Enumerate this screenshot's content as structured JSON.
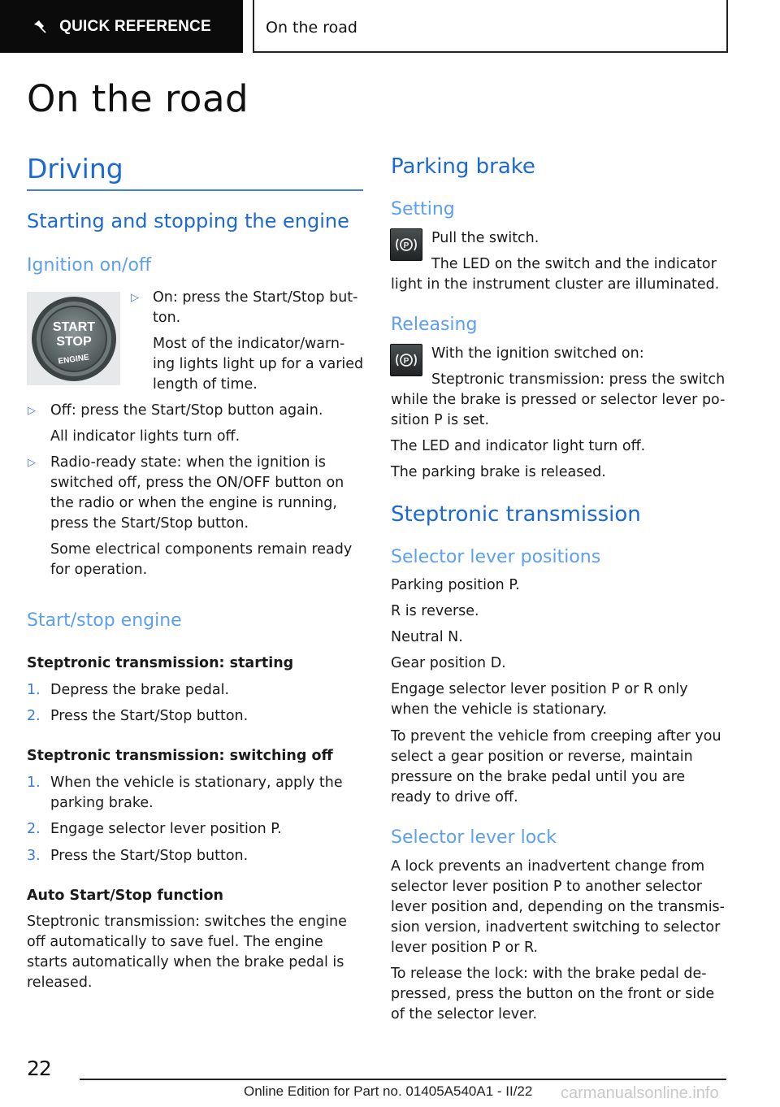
{
  "header": {
    "tab_label": "QUICK REFERENCE",
    "section_label": "On the road"
  },
  "page_title": "On the road",
  "left": {
    "driving": "Driving",
    "starting_stopping": "Starting and stopping the engine",
    "ignition": "Ignition on/off",
    "ignition_bullets": [
      {
        "line1": "On: press the Start/Stop but-",
        "line2": "ton.",
        "note1": "Most of the indicator/warn-",
        "note2": "ing lights light up for a varied",
        "note3": "length of time."
      },
      {
        "line1": "Off: press the Start/Stop button again.",
        "note1": "All indicator lights turn off."
      },
      {
        "line1": "Radio-ready state: when the ignition is",
        "line2": "switched off, press the ON/OFF button on",
        "line3": "the radio or when the engine is running,",
        "line4": "press the Start/Stop button.",
        "note1": "Some electrical components remain ready",
        "note2": "for operation."
      }
    ],
    "start_stop_engine": "Start/stop engine",
    "starting_title": "Steptronic transmission: starting",
    "starting_steps": [
      "Depress the brake pedal.",
      "Press the Start/Stop button."
    ],
    "switching_off_title": "Steptronic transmission: switching off",
    "switching_off_steps": [
      {
        "line1": "When the vehicle is stationary, apply the",
        "line2": "parking brake."
      },
      {
        "line1": "Engage selector lever position P."
      },
      {
        "line1": "Press the Start/Stop button."
      }
    ],
    "auto_title": "Auto Start/Stop function",
    "auto_lines": [
      "Steptronic transmission: switches the engine",
      "off automatically to save fuel. The engine",
      "starts automatically when the brake pedal is",
      "released."
    ],
    "image_text": {
      "l1": "START",
      "l2": "STOP",
      "l3": "ENGINE"
    }
  },
  "right": {
    "parking_brake": "Parking brake",
    "setting": "Setting",
    "setting_lines": [
      "Pull the switch.",
      "The LED on the switch and the indicator",
      "light in the instrument cluster are illuminated."
    ],
    "releasing": "Releasing",
    "releasing_lines": [
      "With the ignition switched on:",
      "Steptronic transmission: press the switch",
      "while the brake is pressed or selector lever po-",
      "sition P is set.",
      "The LED and indicator light turn off.",
      "The parking brake is released."
    ],
    "steptronic": "Steptronic transmission",
    "selector_positions": "Selector lever positions",
    "positions_lines": [
      "Parking position P.",
      "R is reverse.",
      "Neutral N.",
      "Gear position D."
    ],
    "engage_lines": [
      "Engage selector lever position P or R only",
      "when the vehicle is stationary."
    ],
    "prevent_lines": [
      "To prevent the vehicle from creeping after you",
      "select a gear position or reverse, maintain",
      "pressure on the brake pedal until you are",
      "ready to drive off."
    ],
    "lock_title": "Selector lever lock",
    "lock_lines": [
      "A lock prevents an inadvertent change from",
      "selector lever position P to another selector",
      "lever position and, depending on the transmis-",
      "sion version, inadvertent switching to selector",
      "lever position P or R."
    ],
    "release_lock_lines": [
      "To release the lock: with the brake pedal de-",
      "pressed, press the button on the front or side",
      "of the selector lever."
    ],
    "pbutton_glyph": "(P)"
  },
  "footer": {
    "page_number": "22",
    "edition": "Online Edition for Part no. 01405A540A1 - II/22",
    "watermark": "carmanualsonline.info"
  },
  "colors": {
    "heading_primary": "#1c69d4",
    "heading_secondary": "#5c9ff0",
    "header_bar": "#0b0b0b"
  }
}
